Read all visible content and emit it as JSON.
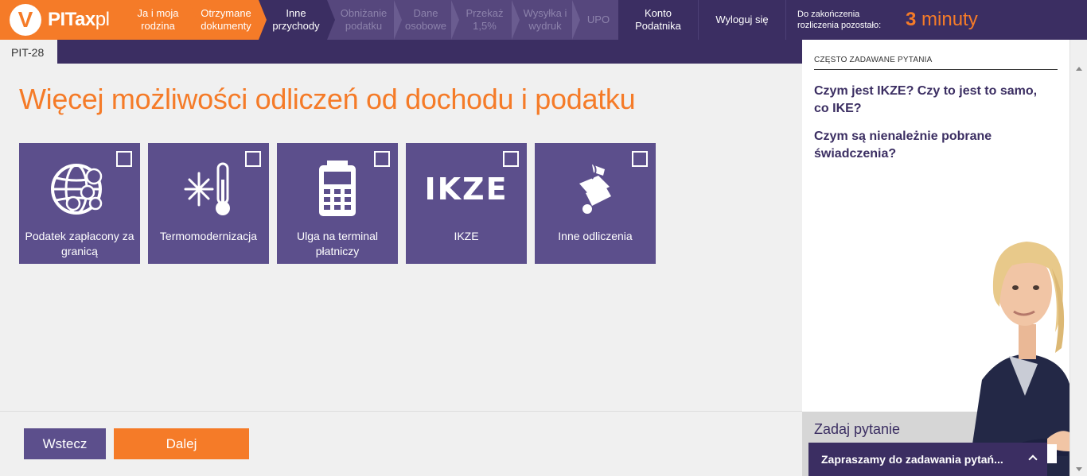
{
  "logo": {
    "brand": "PITax",
    "suffix": "pl",
    "badge": "V"
  },
  "steps": [
    {
      "label": "Ja i moja rodzina",
      "state": "done"
    },
    {
      "label": "Otrzymane dokumenty",
      "state": "done"
    },
    {
      "label": "Inne przychody",
      "state": "current"
    },
    {
      "label": "Obniżanie podatku",
      "state": "future"
    },
    {
      "label": "Dane osobowe",
      "state": "future"
    },
    {
      "label": "Przekaż 1,5%",
      "state": "future"
    },
    {
      "label": "Wysyłka i wydruk",
      "state": "future"
    },
    {
      "label": "UPO",
      "state": "future"
    }
  ],
  "nav": {
    "konto": "Konto Podatnika",
    "logout": "Wyloguj się"
  },
  "timer": {
    "label": "Do zakończenia rozliczenia pozostało:",
    "number": "3",
    "unit": "minuty"
  },
  "form_tab": "PIT-28",
  "main": {
    "title": "Więcej możliwości odliczeń od dochodu i podatku",
    "tiles": [
      {
        "label": "Podatek zapłacony za granicą",
        "icon": "globe-currency-icon"
      },
      {
        "label": "Termomodernizacja",
        "icon": "snowflake-thermometer-icon"
      },
      {
        "label": "Ulga na terminal płatniczy",
        "icon": "payment-terminal-icon"
      },
      {
        "label": "IKZE",
        "icon": "ikze-text-icon",
        "icon_text": "IKZE"
      },
      {
        "label": "Inne odliczenia",
        "icon": "paragraph-document-icon"
      }
    ]
  },
  "footer": {
    "back": "Wstecz",
    "next": "Dalej"
  },
  "sidebar": {
    "faq_heading": "CZĘSTO ZADAWANE PYTANIA",
    "faq": [
      "Czym jest IKZE? Czy to jest to samo, co IKE?",
      "Czym są nienależnie pobrane świadczenia?"
    ],
    "ask_title": "Zadaj pytanie",
    "chat_label": "Zapraszamy do zadawania pytań..."
  },
  "colors": {
    "orange": "#f57b28",
    "purple": "#3b2e62",
    "tile": "#5c4f8c"
  }
}
